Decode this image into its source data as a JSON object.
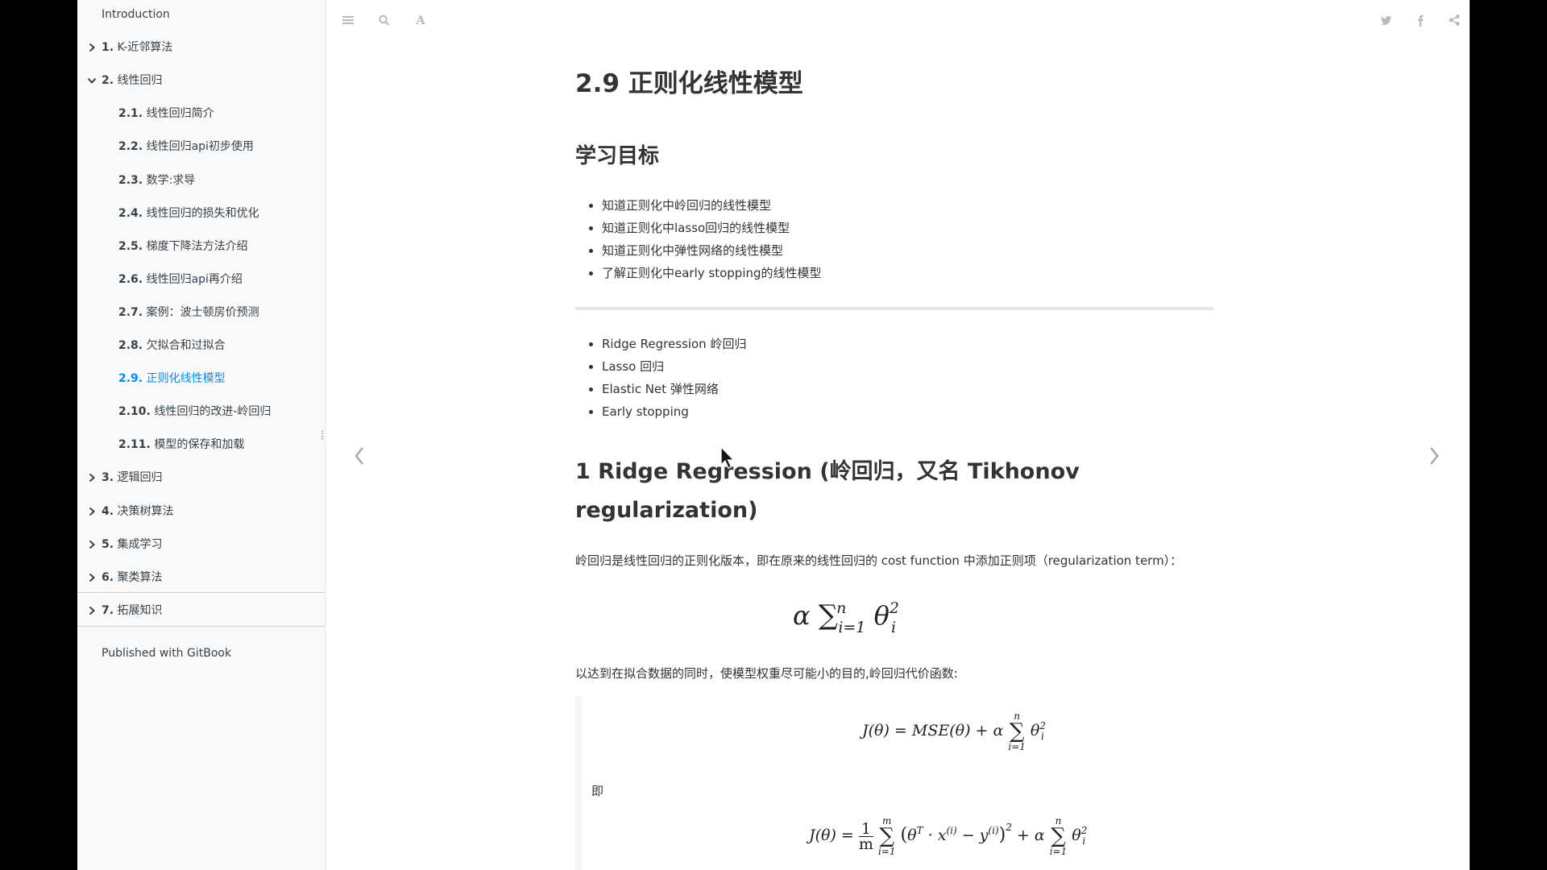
{
  "sidebar": {
    "items": [
      {
        "num": "",
        "label": "Introduction",
        "level": 0,
        "caret": "none"
      },
      {
        "num": "1.",
        "label": "K-近邻算法",
        "level": 1,
        "caret": "right"
      },
      {
        "num": "2.",
        "label": "线性回归",
        "level": 1,
        "caret": "down"
      },
      {
        "num": "2.1.",
        "label": "线性回归简介",
        "level": 2,
        "caret": "none"
      },
      {
        "num": "2.2.",
        "label": "线性回归api初步使用",
        "level": 2,
        "caret": "none"
      },
      {
        "num": "2.3.",
        "label": "数学:求导",
        "level": 2,
        "caret": "none"
      },
      {
        "num": "2.4.",
        "label": "线性回归的损失和优化",
        "level": 2,
        "caret": "none"
      },
      {
        "num": "2.5.",
        "label": "梯度下降法方法介绍",
        "level": 2,
        "caret": "none"
      },
      {
        "num": "2.6.",
        "label": "线性回归api再介绍",
        "level": 2,
        "caret": "none"
      },
      {
        "num": "2.7.",
        "label": "案例：波士顿房价预测",
        "level": 2,
        "caret": "none"
      },
      {
        "num": "2.8.",
        "label": "欠拟合和过拟合",
        "level": 2,
        "caret": "none"
      },
      {
        "num": "2.9.",
        "label": "正则化线性模型",
        "level": 2,
        "caret": "none",
        "active": true
      },
      {
        "num": "2.10.",
        "label": "线性回归的改进-岭回归",
        "level": 2,
        "caret": "none"
      },
      {
        "num": "2.11.",
        "label": "模型的保存和加载",
        "level": 2,
        "caret": "none"
      },
      {
        "num": "3.",
        "label": "逻辑回归",
        "level": 1,
        "caret": "right"
      },
      {
        "num": "4.",
        "label": "决策树算法",
        "level": 1,
        "caret": "right"
      },
      {
        "num": "5.",
        "label": "集成学习",
        "level": 1,
        "caret": "right"
      },
      {
        "num": "6.",
        "label": "聚类算法",
        "level": 1,
        "caret": "right"
      },
      {
        "num": "7.",
        "label": "拓展知识",
        "level": 1,
        "caret": "right"
      }
    ],
    "footer": "Published with GitBook",
    "active_color": "#008cff"
  },
  "toolbar": {
    "left_icons": [
      "menu-icon",
      "search-icon",
      "font-settings-icon"
    ],
    "font_glyph": "A",
    "right_icons": [
      "twitter-icon",
      "facebook-icon",
      "share-icon"
    ]
  },
  "page": {
    "title": "2.9 正则化线性模型",
    "goals_heading": "学习目标",
    "goals": [
      "知道正则化中岭回归的线性模型",
      "知道正则化中lasso回归的线性模型",
      "知道正则化中弹性网络的线性模型",
      "了解正则化中early stopping的线性模型"
    ],
    "topics": [
      "Ridge Regression 岭回归",
      "Lasso 回归",
      "Elastic Net 弹性网络",
      "Early stopping"
    ],
    "section1_heading": "1 Ridge Regression (岭回归，又名 Tikhonov regularization)",
    "para1": "岭回归是线性回归的正则化版本，即在原来的线性回归的 cost function 中添加正则项（regularization term）：",
    "para2": "以达到在拟合数据的同时，使模型权重尽可能小的目的,岭回归代价函数:",
    "ji": "即"
  }
}
